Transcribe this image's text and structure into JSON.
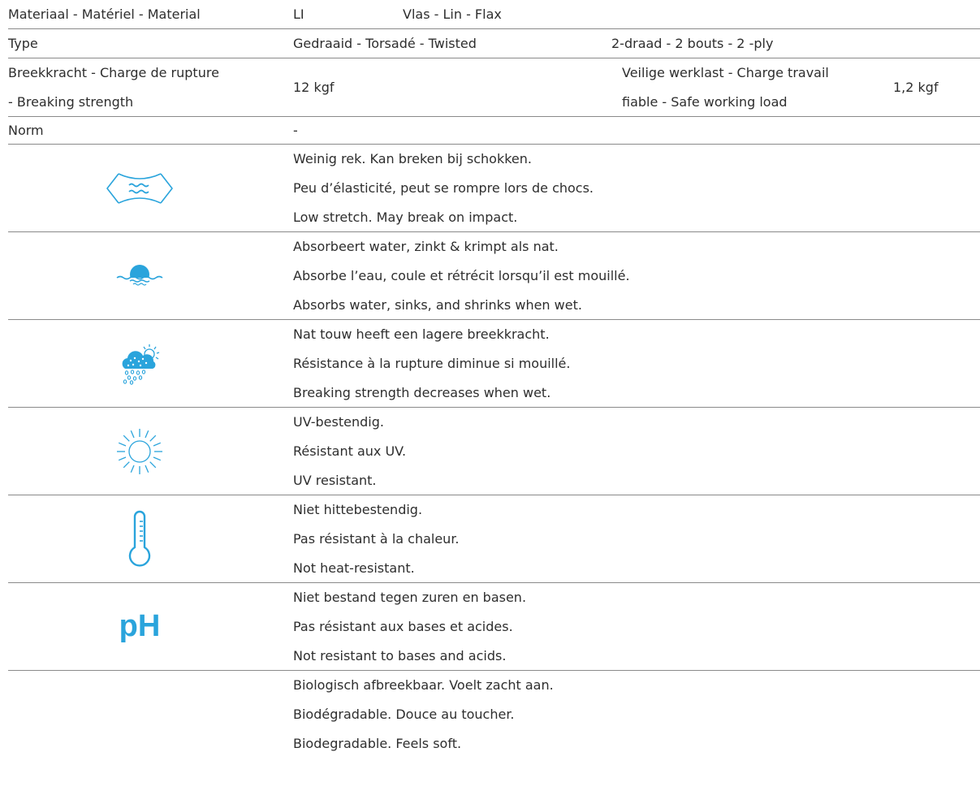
{
  "accent_color": "#2aa4dc",
  "spec": {
    "material": {
      "label": "Materiaal - Matériel - Material",
      "code": "LI",
      "value": "Vlas - Lin - Flax"
    },
    "type": {
      "label": "Type",
      "value": "Gedraaid - Torsadé - Twisted",
      "construction": "2-draad - 2 bouts - 2 -ply"
    },
    "strength": {
      "label_line1": "Breekkracht - Charge de rupture",
      "label_line2": "- Breaking strength",
      "value": "12 kgf",
      "swl_label_line1": "Veilige werklast - Charge travail",
      "swl_label_line2": "fiable - Safe working load",
      "swl_value": "1,2 kgf"
    },
    "norm": {
      "label": "Norm",
      "value": "-"
    }
  },
  "features": [
    {
      "icon": "stretch-icon",
      "lines": [
        "Weinig rek. Kan breken bij schokken.",
        "Peu d’élasticité, peut se rompre lors de chocs.",
        "Low stretch. May break on impact."
      ]
    },
    {
      "icon": "water-absorb-icon",
      "lines": [
        "Absorbeert water, zinkt & krimpt als nat.",
        "Absorbe l’eau, coule et rétrécit lorsqu’il est mouillé.",
        "Absorbs water, sinks, and shrinks when wet."
      ]
    },
    {
      "icon": "rain-cloud-icon",
      "lines": [
        "Nat touw heeft een lagere breekkracht.",
        "Résistance à la rupture diminue si mouillé.",
        "Breaking strength decreases when wet."
      ]
    },
    {
      "icon": "sun-icon",
      "lines": [
        "UV-bestendig.",
        "Résistant aux UV.",
        "UV resistant."
      ]
    },
    {
      "icon": "thermometer-icon",
      "lines": [
        "Niet hittebestendig.",
        "Pas résistant à la chaleur.",
        "Not heat-resistant."
      ]
    },
    {
      "icon": "ph-icon",
      "icon_text": "pH",
      "lines": [
        "Niet bestand tegen zuren en basen.",
        "Pas résistant aux bases et acides.",
        "Not resistant to bases and acids."
      ]
    },
    {
      "icon": "",
      "lines": [
        "Biologisch afbreekbaar. Voelt zacht aan.",
        "Biodégradable. Douce au toucher.",
        "Biodegradable. Feels soft."
      ]
    }
  ]
}
